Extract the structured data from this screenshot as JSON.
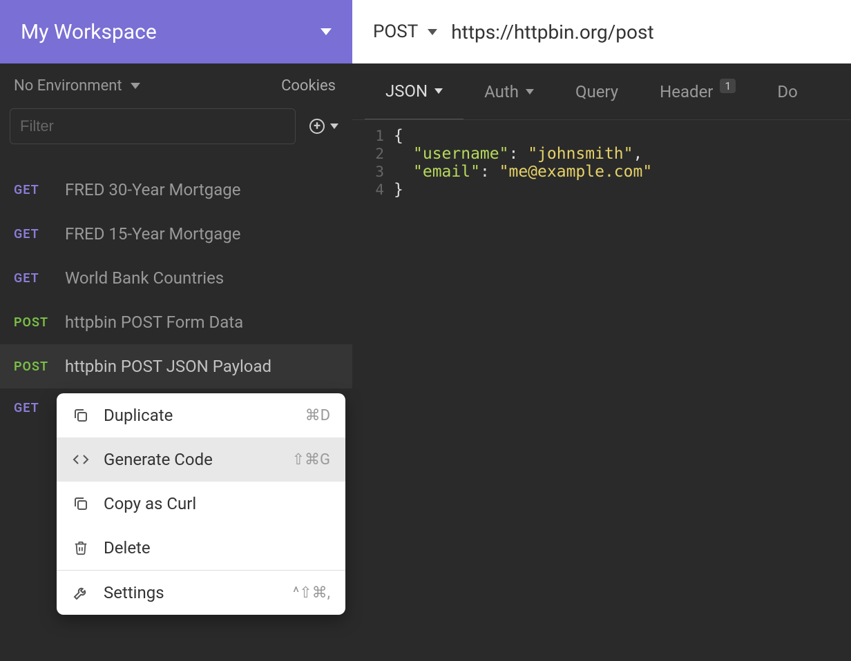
{
  "workspace": {
    "title": "My Workspace"
  },
  "env": {
    "label": "No Environment",
    "cookies": "Cookies"
  },
  "filter": {
    "placeholder": "Filter"
  },
  "requests": [
    {
      "method": "GET",
      "methodClass": "get",
      "name": "FRED 30-Year Mortgage",
      "selected": false
    },
    {
      "method": "GET",
      "methodClass": "get",
      "name": "FRED 15-Year Mortgage",
      "selected": false
    },
    {
      "method": "GET",
      "methodClass": "get",
      "name": "World Bank Countries",
      "selected": false
    },
    {
      "method": "POST",
      "methodClass": "post",
      "name": "httpbin POST Form Data",
      "selected": false
    },
    {
      "method": "POST",
      "methodClass": "post",
      "name": "httpbin POST JSON Payload",
      "selected": true
    },
    {
      "method": "GET",
      "methodClass": "get",
      "name": "",
      "selected": false
    }
  ],
  "context_menu": [
    {
      "icon": "duplicate",
      "label": "Duplicate",
      "shortcut": "⌘D",
      "hover": false
    },
    {
      "icon": "code",
      "label": "Generate Code",
      "shortcut": "⇧⌘G",
      "hover": true
    },
    {
      "icon": "duplicate",
      "label": "Copy as Curl",
      "shortcut": "",
      "hover": false
    },
    {
      "icon": "trash",
      "label": "Delete",
      "shortcut": "",
      "hover": false
    },
    {
      "divider": true
    },
    {
      "icon": "wrench",
      "label": "Settings",
      "shortcut": "^⇧⌘,",
      "hover": false
    }
  ],
  "request_bar": {
    "method": "POST",
    "url": "https://httpbin.org/post"
  },
  "tabs": {
    "body": {
      "label": "JSON"
    },
    "auth": {
      "label": "Auth"
    },
    "query": {
      "label": "Query"
    },
    "header": {
      "label": "Header",
      "badge": "1"
    },
    "docs": {
      "label": "Do"
    }
  },
  "editor": {
    "lines": [
      "1",
      "2",
      "3",
      "4"
    ],
    "json_body": {
      "line1_open": "{",
      "line2_key": "\"username\"",
      "line2_val": "\"johnsmith\"",
      "line2_comma": ",",
      "line3_key": "\"email\"",
      "line3_val": "\"me@example.com\"",
      "line4_close": "}"
    }
  }
}
